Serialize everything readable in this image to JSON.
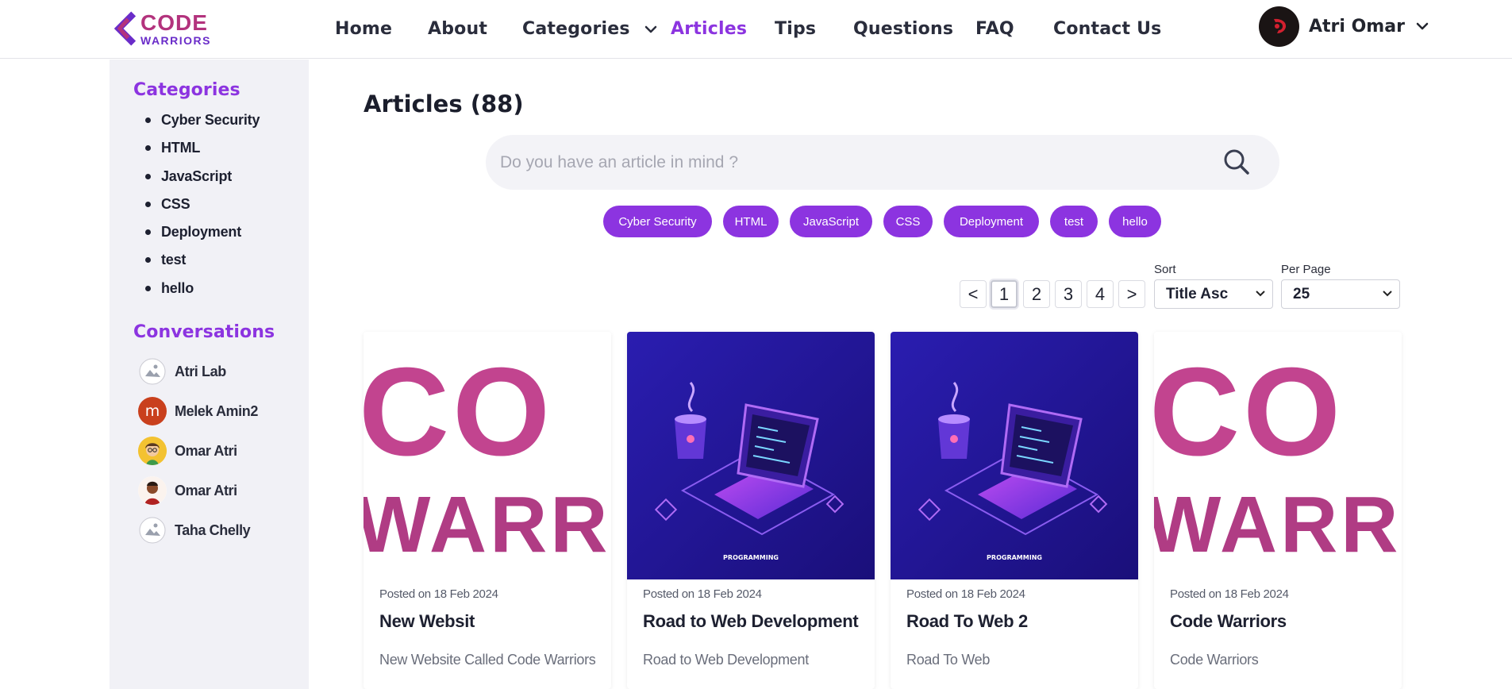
{
  "brand": {
    "line1": "CODE",
    "line2": "WARRIORS"
  },
  "nav": {
    "items": [
      {
        "label": "Home"
      },
      {
        "label": "About"
      },
      {
        "label": "Categories"
      },
      {
        "label": "Articles"
      },
      {
        "label": "Tips"
      },
      {
        "label": "Questions"
      },
      {
        "label": "FAQ"
      },
      {
        "label": "Contact Us"
      }
    ],
    "active": "Articles"
  },
  "user": {
    "name": "Atri Omar"
  },
  "sidebar": {
    "categories_heading": "Categories",
    "categories": [
      "Cyber Security",
      "HTML",
      "JavaScript",
      "CSS",
      "Deployment",
      "test",
      "hello"
    ],
    "conversations_heading": "Conversations",
    "conversations": [
      {
        "name": "Atri Lab",
        "avatar": "broken-image-icon"
      },
      {
        "name": "Melek Amin2",
        "avatar": "letter-avatar",
        "initial": "m"
      },
      {
        "name": "Omar Atri",
        "avatar": "cartoon-avatar"
      },
      {
        "name": "Omar Atri",
        "avatar": "cartoon-avatar"
      },
      {
        "name": "Taha Chelly",
        "avatar": "broken-image-icon"
      }
    ]
  },
  "main": {
    "title": "Articles (88)",
    "search": {
      "placeholder": "Do you have an article in mind ?"
    },
    "chips": [
      "Cyber Security",
      "HTML",
      "JavaScript",
      "CSS",
      "Deployment",
      "test",
      "hello"
    ],
    "pagination": {
      "prev": "<",
      "pages": [
        "1",
        "2",
        "3",
        "4"
      ],
      "current": "1",
      "next": ">"
    },
    "sort": {
      "label": "Sort",
      "value": "Title Asc"
    },
    "per_page": {
      "label": "Per Page",
      "value": "25"
    }
  },
  "articles": [
    {
      "image": "code-warriors-logo",
      "date": "Posted on 18 Feb 2024",
      "title": "New Websit",
      "description": "New Website Called Code Warriors"
    },
    {
      "image": "laptop-illustration",
      "date": "Posted on 18 Feb 2024",
      "title": "Road to Web Development",
      "description": "Road to Web Development"
    },
    {
      "image": "laptop-illustration",
      "date": "Posted on 18 Feb 2024",
      "title": "Road To Web 2",
      "description": "Road To Web"
    },
    {
      "image": "code-warriors-logo",
      "date": "Posted on 18 Feb 2024",
      "title": "Code Warriors",
      "description": "Code Warriors"
    }
  ],
  "colors": {
    "accent": "#8c34e0",
    "brand_pink": "#b3337d",
    "sidebar_bg": "#f1f1f6"
  }
}
